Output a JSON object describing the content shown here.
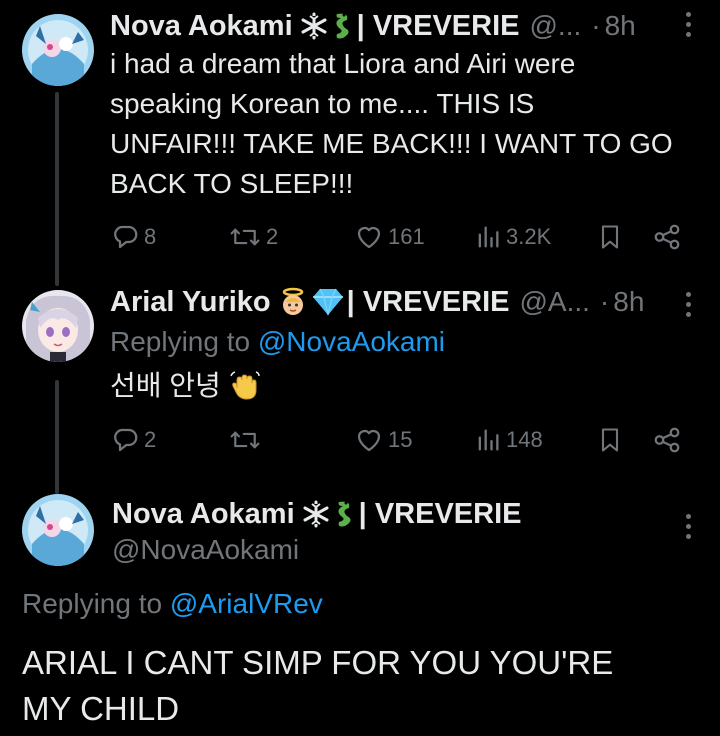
{
  "tweets": [
    {
      "display_name": "Nova Aokami",
      "emoji": [
        "snowflake-emoji",
        "dragon-emoji"
      ],
      "affiliation": "| VREVERIE",
      "handle_truncated": "@...",
      "separator": "·",
      "time": "8h",
      "text_lines": [
        "i had a dream that Liora and Airi were",
        "speaking Korean to me.... THIS IS",
        "UNFAIR!!! TAKE ME BACK!!! I WANT TO GO",
        "BACK TO SLEEP!!!"
      ],
      "replies": "8",
      "retweets": "2",
      "likes": "161",
      "views": "3.2K"
    },
    {
      "display_name": "Arial Yuriko",
      "emoji": [
        "angel-emoji",
        "gem-emoji"
      ],
      "affiliation": "| VREVERIE",
      "handle_truncated": "@A...",
      "separator": "·",
      "time": "8h",
      "replying_prefix": "Replying to",
      "replying_handle": "@NovaAokami",
      "text": "선배 안녕",
      "text_emoji": "waving-hand-emoji",
      "replies": "2",
      "retweets": "",
      "likes": "15",
      "views": "148"
    },
    {
      "display_name": "Nova Aokami",
      "emoji": [
        "snowflake-emoji",
        "dragon-emoji"
      ],
      "affiliation": "| VREVERIE",
      "handle": "@NovaAokami",
      "replying_prefix": "Replying to",
      "replying_handle": "@ArialVRev",
      "text_lines": [
        "ARIAL I CANT SIMP FOR YOU YOU'RE",
        "MY CHILD"
      ]
    }
  ],
  "colors": {
    "background": "#000000",
    "text": "#e7e9ea",
    "muted": "#71767b",
    "link": "#1d9bf0",
    "thread_line": "#333639"
  }
}
